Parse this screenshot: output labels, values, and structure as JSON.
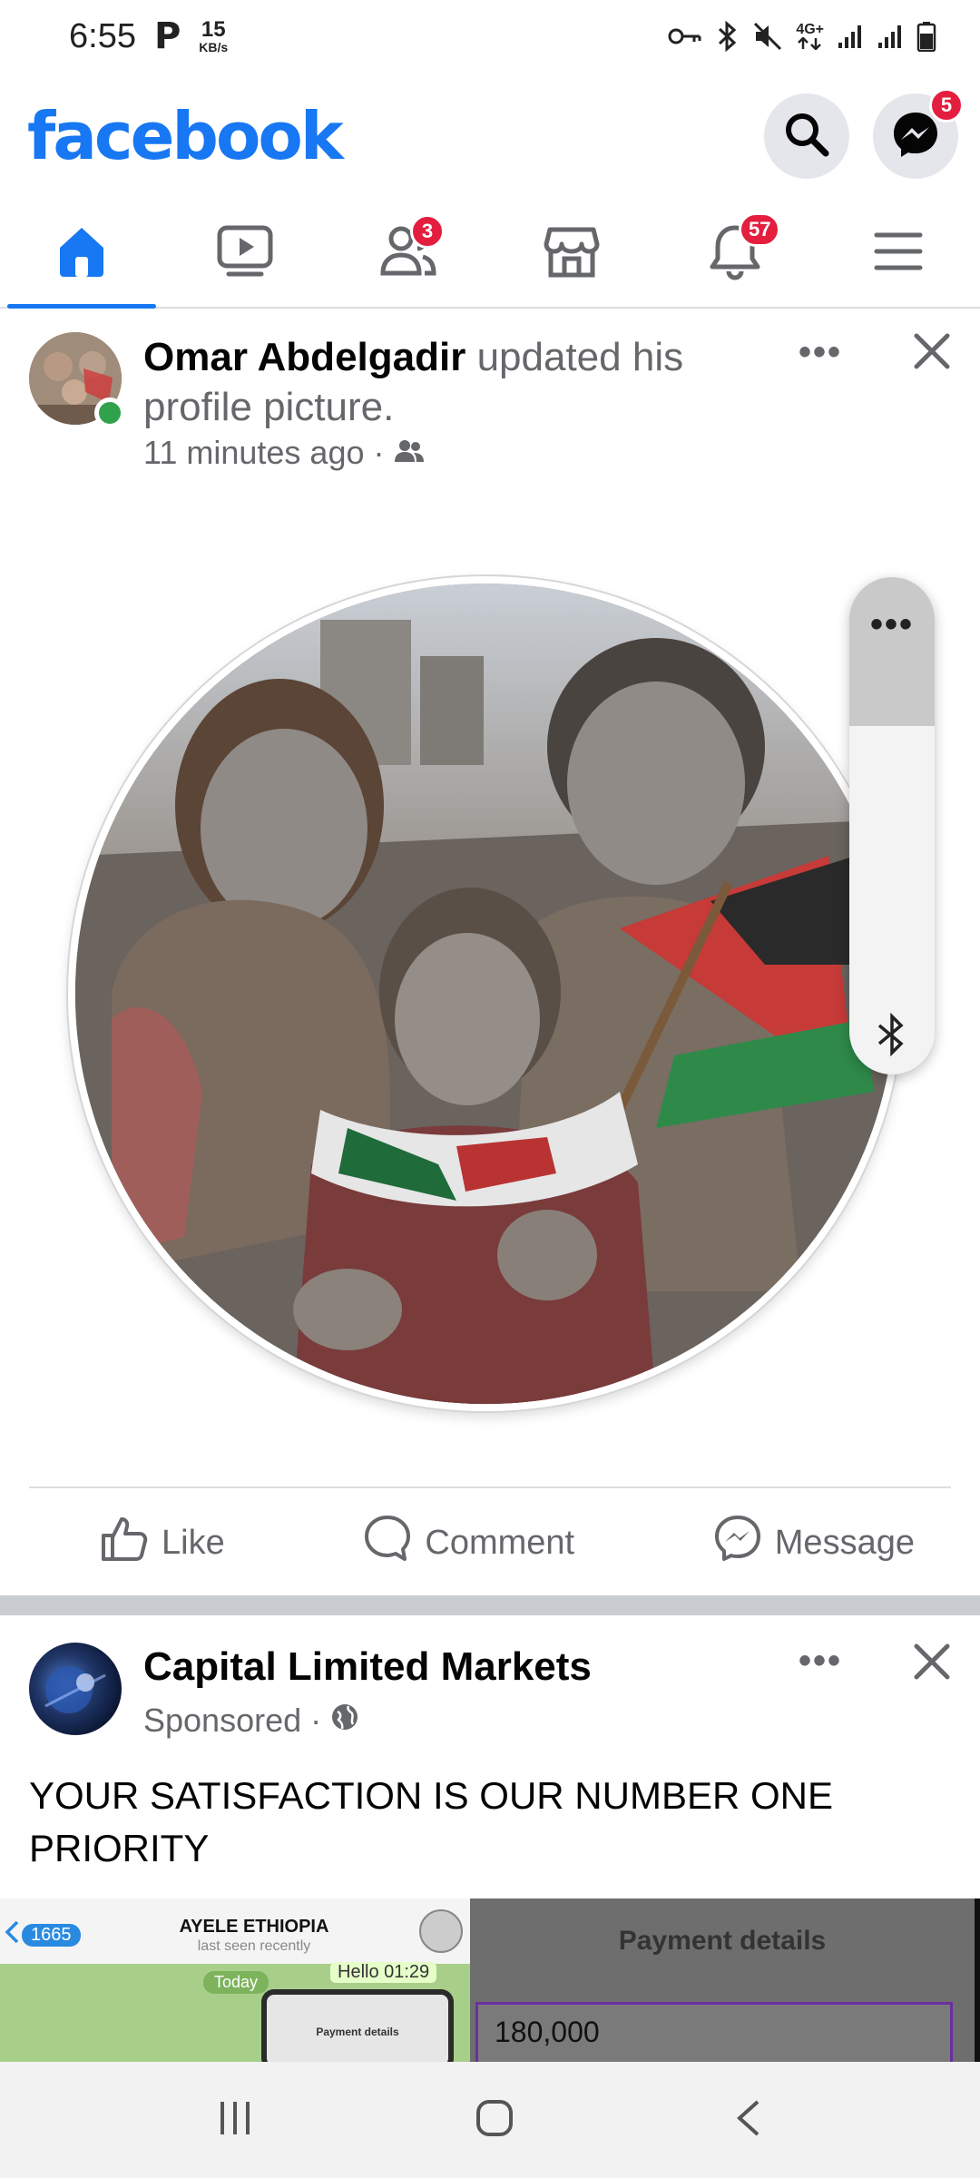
{
  "status_bar": {
    "time": "6:55",
    "p_icon": "P",
    "speed_value": "15",
    "speed_unit": "KB/s",
    "network_label": "4G+",
    "icons": [
      "key-icon",
      "bluetooth-icon",
      "mute-icon",
      "signal-icon",
      "signal-icon",
      "battery-icon"
    ]
  },
  "header": {
    "logo": "facebook",
    "messenger_badge": "5",
    "colors": {
      "brand": "#1877f2",
      "badge": "#e41e3f"
    }
  },
  "nav": {
    "tabs": [
      {
        "name": "home",
        "icon": "home-icon",
        "active": true,
        "badge": ""
      },
      {
        "name": "video",
        "icon": "video-icon",
        "active": false,
        "badge": ""
      },
      {
        "name": "friends",
        "icon": "friends-icon",
        "active": false,
        "badge": "3"
      },
      {
        "name": "marketplace",
        "icon": "marketplace-icon",
        "active": false,
        "badge": ""
      },
      {
        "name": "notifications",
        "icon": "bell-icon",
        "active": false,
        "badge": "57"
      },
      {
        "name": "menu",
        "icon": "menu-icon",
        "active": false,
        "badge": ""
      }
    ]
  },
  "post1": {
    "author": "Omar Abdelgadir",
    "action_text": "updated his profile picture.",
    "time": "11 minutes ago",
    "separator": "·",
    "more": "•••",
    "actions": {
      "like": "Like",
      "comment": "Comment",
      "message": "Message"
    }
  },
  "volume_panel": {
    "more": "•••",
    "level": 0.3
  },
  "post2": {
    "author": "Capital Limited Markets",
    "sponsored": "Sponsored",
    "separator": "·",
    "more": "•••",
    "text": "YOUR SATISFACTION IS OUR NUMBER ONE PRIORITY",
    "image": {
      "left": {
        "back_count": "1665",
        "chat_name": "AYELE ETHIOPIA",
        "chat_status": "last seen recently",
        "today": "Today",
        "hello": "Hello 01:29",
        "inner_label": "Payment details"
      },
      "right": {
        "title": "Payment details",
        "field_value": "180,000"
      }
    }
  }
}
